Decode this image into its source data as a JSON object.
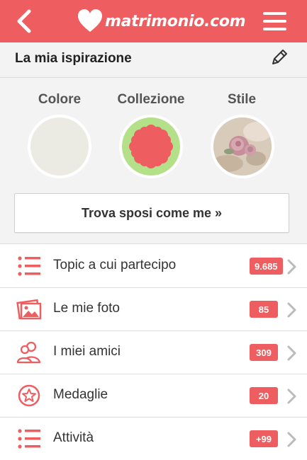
{
  "header": {
    "back_icon": "chevron-left-icon",
    "logo_text": "matrimonio.com",
    "menu_icon": "hamburger-menu-icon",
    "bg_color": "#ee5e60"
  },
  "inspiration": {
    "title": "La mia ispirazione",
    "edit_icon": "pencil-icon",
    "categories": [
      {
        "label": "Colore"
      },
      {
        "label": "Collezione"
      },
      {
        "label": "Stile"
      }
    ],
    "cta_label": "Trova sposi come me »"
  },
  "menu": {
    "items": [
      {
        "icon": "list-icon",
        "label": "Topic a cui partecipo",
        "count": "9.685"
      },
      {
        "icon": "photo-icon",
        "label": "Le mie foto",
        "count": "85"
      },
      {
        "icon": "friends-icon",
        "label": "I miei amici",
        "count": "309"
      },
      {
        "icon": "medal-star-icon",
        "label": "Medaglie",
        "count": "20"
      },
      {
        "icon": "list-icon",
        "label": "Attività",
        "count": "+99"
      }
    ]
  },
  "colors": {
    "accent": "#ee5e60",
    "panel": "#f3f3f3"
  }
}
